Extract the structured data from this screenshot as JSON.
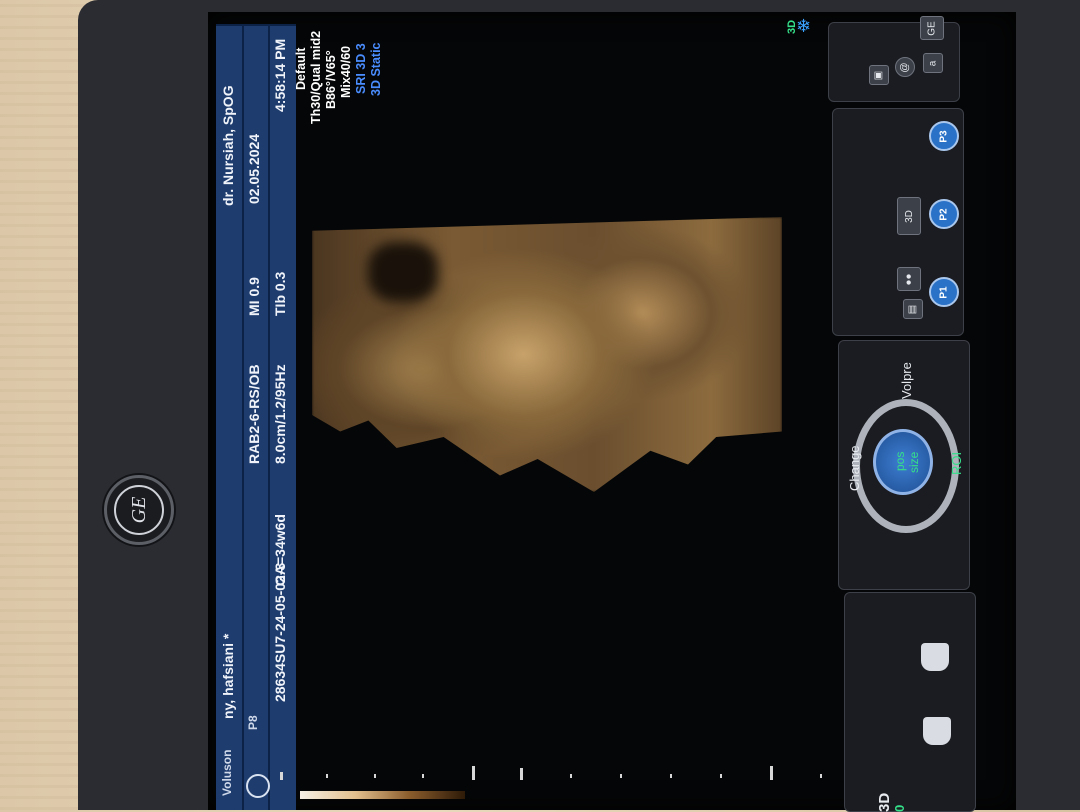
{
  "system": {
    "model": "Voluson",
    "preset": "P8"
  },
  "header": {
    "patient": "ny, hafsiani *",
    "patient_id": "28634SU7-24-05-02-3",
    "gest_age": "GA=34w6d",
    "probe": "RAB2-6-RS/OB",
    "scan_params": "8.0cm/1.2/95Hz",
    "mi": "MI  0.9",
    "tib": "TIb  0.3",
    "doctor": "dr. Nursiah, SpOG",
    "date": "02.05.2024",
    "time": "4:58:14 PM"
  },
  "image_settings": {
    "line1": "Default",
    "line2": "Th30/Qual mid2",
    "line3": "B86°/V65°",
    "line4": "Mix40/60",
    "line5": "SRI 3D 3",
    "line6": "3D Static"
  },
  "status": {
    "mode_3d": "3D",
    "freeze_icon": "snowflake-icon"
  },
  "touch_panel": {
    "logo": "GE",
    "at_label": "@",
    "a_label": "a",
    "p1": "P1",
    "p2": "P2",
    "p3": "P3",
    "p2_label": "3D",
    "wheel": {
      "change": "Change",
      "volpre": "Volpre",
      "pos": "pos",
      "size": "size",
      "roi": "ROI"
    },
    "bottom_mode": "3D",
    "bottom_value": "0"
  },
  "colors": {
    "header_blue": "#1e3c6e",
    "accent_green": "#35e08a",
    "accent_blue": "#4a8dff",
    "button_blue": "#2a72c8"
  }
}
